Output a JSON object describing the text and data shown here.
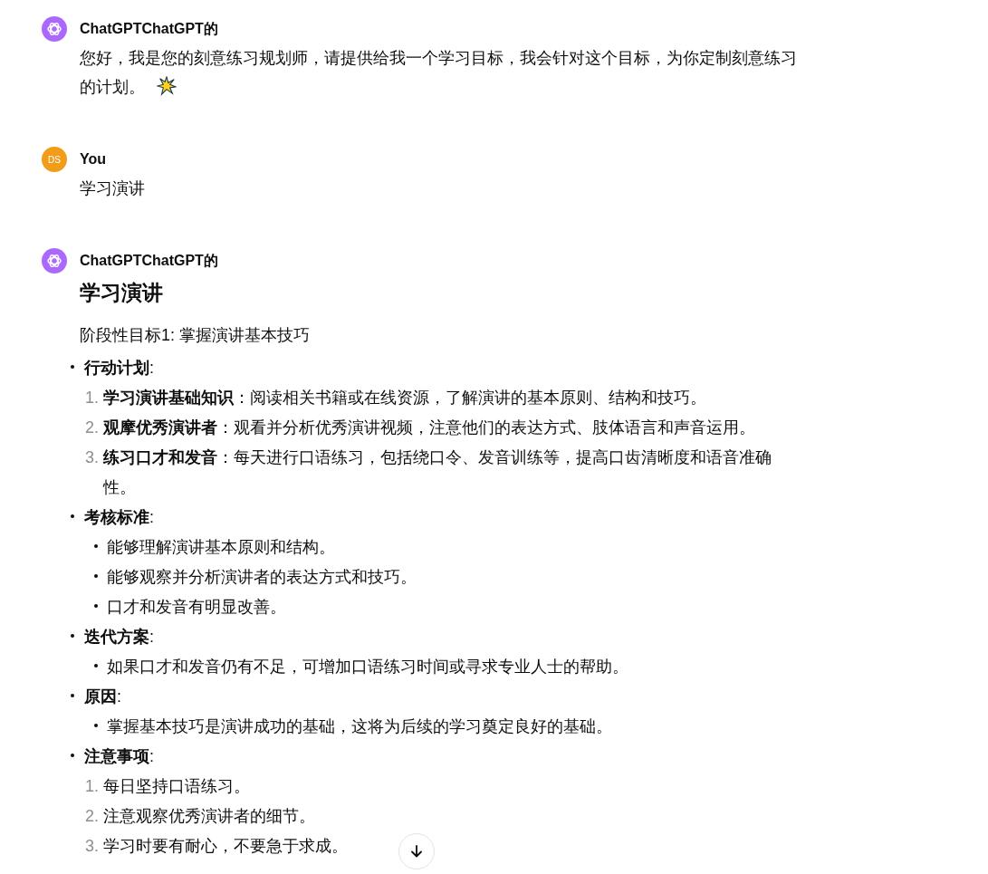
{
  "messages": [
    {
      "kind": "assistant",
      "author": "ChatGPTChatGPT的",
      "blocks": [
        {
          "kind": "paragraph",
          "text": "您好，我是您的刻意练习规划师，请提供给我一个学习目标，我会针对这个目标，为你定制刻意练习的计划。",
          "emoji": true
        }
      ]
    },
    {
      "kind": "user",
      "author": "You",
      "avatar": "DS",
      "blocks": [
        {
          "kind": "paragraph",
          "text": "学习演讲",
          "emoji": false
        }
      ]
    },
    {
      "kind": "assistant",
      "author": "ChatGPTChatGPT的",
      "blocks": [
        {
          "kind": "heading",
          "text": "学习演讲"
        },
        {
          "kind": "paragraph",
          "text": "阶段性目标1: 掌握演讲基本技巧",
          "emoji": false
        },
        {
          "kind": "sections",
          "items": [
            {
              "title": "**行动计划**:",
              "kind": "ordered",
              "items": [
                {
                  "num": "1.",
                  "text": "**学习演讲基础知识**：阅读相关书籍或在线资源，了解演讲的基本原则、结构和技巧。"
                },
                {
                  "num": "2.",
                  "text": "**观摩优秀演讲者**：观看并分析优秀演讲视频，注意他们的表达方式、肢体语言和声音运用。"
                },
                {
                  "num": "3.",
                  "text": "**练习口才和发音**：每天进行口语练习，包括绕口令、发音训练等，提高口齿清晰度和语音准确性。"
                }
              ]
            },
            {
              "title": "**考核标准**:",
              "kind": "bullet",
              "items": [
                {
                  "text": "能够理解演讲基本原则和结构。"
                },
                {
                  "text": "能够观察并分析演讲者的表达方式和技巧。"
                },
                {
                  "text": "口才和发音有明显改善。"
                }
              ]
            },
            {
              "title": "**迭代方案**:",
              "kind": "bullet",
              "items": [
                {
                  "text": "如果口才和发音仍有不足，可增加口语练习时间或寻求专业人士的帮助。"
                }
              ]
            },
            {
              "title": "**原因**:",
              "kind": "bullet",
              "items": [
                {
                  "text": "掌握基本技巧是演讲成功的基础，这将为后续的学习奠定良好的基础。"
                }
              ]
            },
            {
              "title": "**注意事项**:",
              "kind": "ordered",
              "items": [
                {
                  "num": "1.",
                  "text": "每日坚持口语练习。"
                },
                {
                  "num": "2.",
                  "text": "注意观察优秀演讲者的细节。"
                },
                {
                  "num": "3.",
                  "text": "学习时要有耐心，不要急于求成。"
                }
              ]
            }
          ]
        }
      ]
    }
  ]
}
